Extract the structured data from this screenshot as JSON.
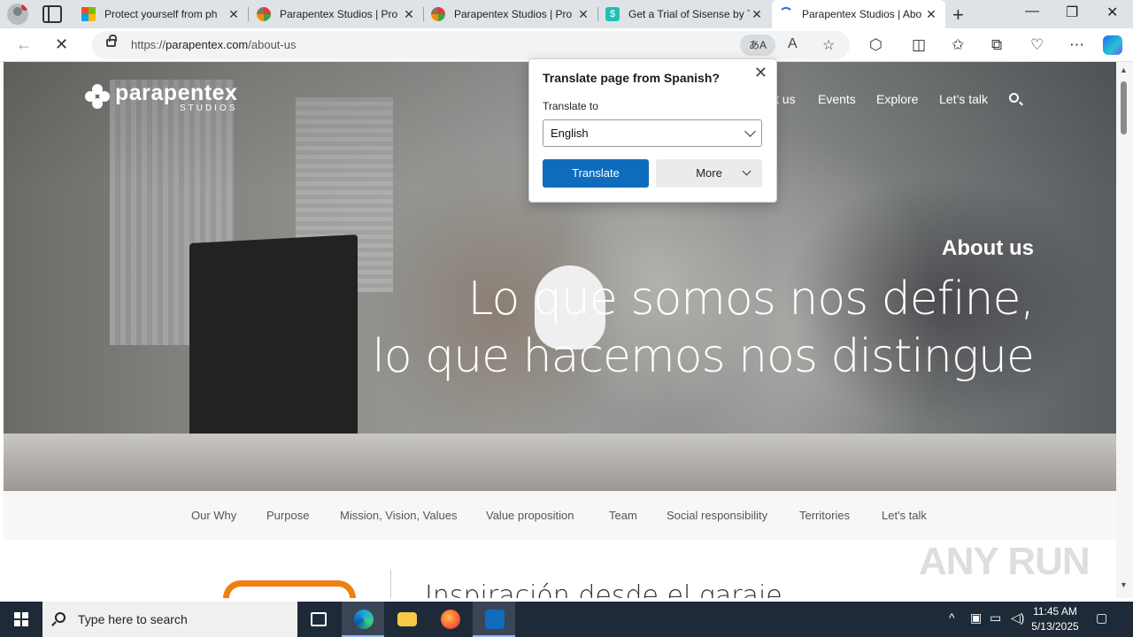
{
  "browser": {
    "tabs": [
      {
        "title": "Protect yourself from ph",
        "favicon": "microsoft-icon",
        "active": false
      },
      {
        "title": "Parapentex Studios | Pro",
        "favicon": "parapentex-icon",
        "active": false
      },
      {
        "title": "Parapentex Studios | Pro",
        "favicon": "parapentex-icon",
        "active": false
      },
      {
        "title": "Get a Trial of Sisense by T",
        "favicon": "sisense-icon",
        "active": false
      },
      {
        "title": "Parapentex Studios | Abo",
        "favicon": "loading-icon",
        "active": true
      }
    ],
    "url_scheme": "https://",
    "url_host": "parapentex.com",
    "url_path": "/about-us",
    "translate_glyph": "あA"
  },
  "translate_popup": {
    "title": "Translate page from Spanish?",
    "label": "Translate to",
    "selected_language": "English",
    "translate_button": "Translate",
    "more_button": "More",
    "accent": "#0f6cbd"
  },
  "site": {
    "logo_name": "parapentex",
    "logo_sub": "STUDIOS",
    "nav": {
      "about_partial": "t us",
      "events": "Events",
      "explore": "Explore",
      "lets_talk": "Let’s talk"
    },
    "hero": {
      "label": "About us",
      "line1": "Lo que somos nos define,",
      "line2": "lo que hacemos nos distingue"
    },
    "subnav": [
      "Our Why",
      "Purpose",
      "Mission, Vision, Values",
      "Value proposition",
      "Team",
      "Social responsibility",
      "Territories",
      "Let's talk"
    ],
    "content_title": "Inspiración desde el garaje",
    "brand_orange": "#f07e13"
  },
  "watermark": "ANY RUN",
  "taskbar": {
    "search_placeholder": "Type here to search",
    "time": "11:45 AM",
    "date": "5/13/2025"
  }
}
